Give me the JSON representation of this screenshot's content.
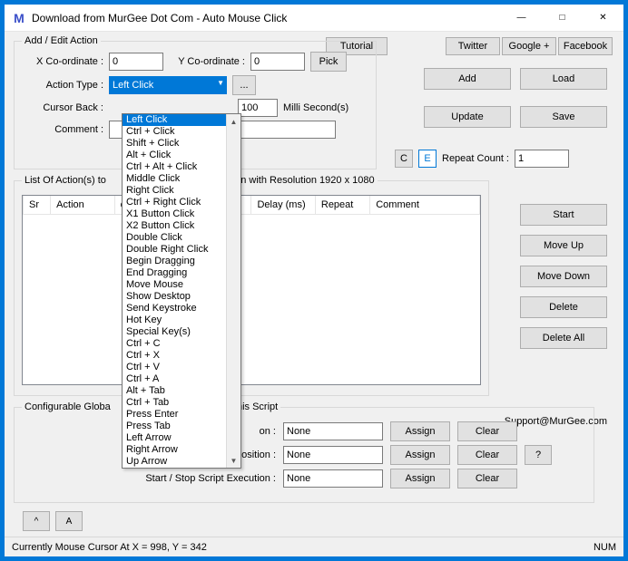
{
  "window": {
    "title": "Download from MurGee Dot Com - Auto Mouse Click"
  },
  "topButtons": {
    "tutorial": "Tutorial",
    "twitter": "Twitter",
    "google": "Google +",
    "facebook": "Facebook"
  },
  "addEdit": {
    "legend": "Add / Edit Action",
    "xLabel": "X Co-ordinate :",
    "xValue": "0",
    "yLabel": "Y Co-ordinate :",
    "yValue": "0",
    "pick": "Pick",
    "actionTypeLabel": "Action Type :",
    "actionTypeValue": "Left Click",
    "ellipsis": "...",
    "cursorBackLabel": "Cursor Back :",
    "delayValue": "100",
    "delayUnit": "Milli Second(s)",
    "commentLabel": "Comment :",
    "c": "C",
    "e": "E",
    "repeatCountLabel": "Repeat Count :",
    "repeatCountValue": "1"
  },
  "actionTypeOptions": [
    "Left Click",
    "Ctrl + Click",
    "Shift + Click",
    "Alt + Click",
    "Ctrl + Alt + Click",
    "Middle Click",
    "Right Click",
    "Ctrl + Right Click",
    "X1 Button Click",
    "X2 Button Click",
    "Double Click",
    "Double Right Click",
    "Begin Dragging",
    "End Dragging",
    "Move Mouse",
    "Show Desktop",
    "Send Keystroke",
    "Hot Key",
    "Special Key(s)",
    "Ctrl + C",
    "Ctrl + X",
    "Ctrl + V",
    "Ctrl + A",
    "Alt + Tab",
    "Ctrl + Tab",
    "Press Enter",
    "Press Tab",
    "Left Arrow",
    "Right Arrow",
    "Up Arrow"
  ],
  "rightButtons": {
    "add": "Add",
    "load": "Load",
    "update": "Update",
    "save": "Save"
  },
  "list": {
    "legend": "List Of Action(s) to",
    "resInfo": "een with Resolution 1920 x 1080",
    "columns": [
      "Sr",
      "Action",
      "ck",
      "Delay (ms)",
      "Repeat",
      "Comment"
    ]
  },
  "sideButtons": {
    "start": "Start",
    "moveUp": "Move Up",
    "moveDown": "Move Down",
    "delete": "Delete",
    "deleteAll": "Delete All"
  },
  "global": {
    "legendLeft": "Configurable Globa",
    "legendRight": "this Script",
    "subLabel": "Get Mouse Cursor Position :",
    "gPrefix": "G",
    "onSuffix": "on :",
    "row1Value": "None",
    "row2Label": "Get Mouse Cursor Position :",
    "row2Value": "None",
    "row3Label": "Start / Stop Script Execution :",
    "row3Value": "None",
    "assign": "Assign",
    "clear": "Clear",
    "help": "?"
  },
  "support": "Support@MurGee.com",
  "footer": {
    "caret": "^",
    "a": "A"
  },
  "status": {
    "text": "Currently Mouse Cursor At X = 998, Y = 342",
    "num": "NUM"
  }
}
